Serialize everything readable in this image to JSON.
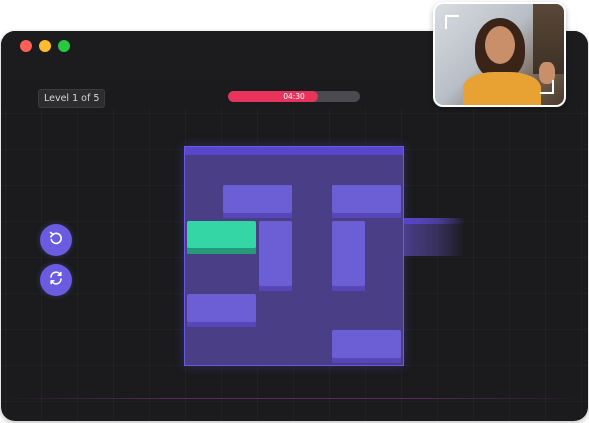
{
  "window": {
    "controls": [
      "close",
      "minimize",
      "maximize"
    ]
  },
  "header": {
    "level_label": "Level 1 of 5",
    "timer_text": "04:30",
    "timer_progress": 0.68
  },
  "controls": {
    "undo_icon": "undo-icon",
    "restart_icon": "restart-icon"
  },
  "colors": {
    "accent": "#6a5be0",
    "block": "#6c5fd6",
    "target_block": "#34d6a6",
    "timer": "#e8345c",
    "board": "#4a3f86"
  },
  "board": {
    "grid_size": 6,
    "target_block": {
      "row": 2,
      "col": 0,
      "length": 2,
      "orientation": "horizontal"
    },
    "blocks": [
      {
        "row": 1,
        "col": 1,
        "length": 2,
        "orientation": "horizontal"
      },
      {
        "row": 1,
        "col": 4,
        "length": 2,
        "orientation": "horizontal"
      },
      {
        "row": 2,
        "col": 2,
        "length": 2,
        "orientation": "vertical"
      },
      {
        "row": 2,
        "col": 4,
        "length": 2,
        "orientation": "vertical"
      },
      {
        "row": 4,
        "col": 0,
        "length": 2,
        "orientation": "horizontal"
      },
      {
        "row": 5,
        "col": 4,
        "length": 2,
        "orientation": "horizontal"
      }
    ],
    "exit_row": 2
  },
  "webcam": {
    "icon": "video-feed"
  }
}
